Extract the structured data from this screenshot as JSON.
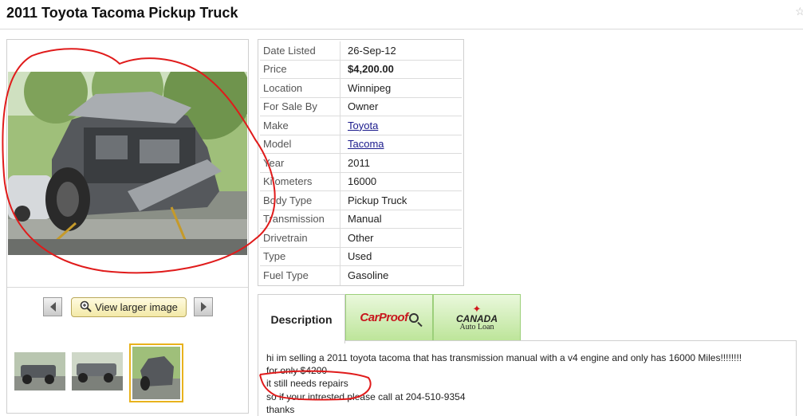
{
  "listing": {
    "title": "2011 Toyota Tacoma Pickup Truck"
  },
  "gallery": {
    "view_larger_label": "View larger image"
  },
  "details": [
    {
      "label": "Date Listed",
      "value": "26-Sep-12",
      "style": ""
    },
    {
      "label": "Price",
      "value": "$4,200.00",
      "style": "bold"
    },
    {
      "label": "Location",
      "value": "Winnipeg",
      "style": ""
    },
    {
      "label": "For Sale By",
      "value": "Owner",
      "style": ""
    },
    {
      "label": "Make",
      "value": "Toyota",
      "style": "link"
    },
    {
      "label": "Model",
      "value": "Tacoma",
      "style": "link"
    },
    {
      "label": "Year",
      "value": "2011",
      "style": ""
    },
    {
      "label": "Kilometers",
      "value": "16000",
      "style": ""
    },
    {
      "label": "Body Type",
      "value": "Pickup Truck",
      "style": ""
    },
    {
      "label": "Transmission",
      "value": "Manual",
      "style": ""
    },
    {
      "label": "Drivetrain",
      "value": "Other",
      "style": ""
    },
    {
      "label": "Type",
      "value": "Used",
      "style": ""
    },
    {
      "label": "Fuel Type",
      "value": "Gasoline",
      "style": ""
    }
  ],
  "tabs": {
    "description": "Description",
    "carproof": "CarProof",
    "canada_big": "CANADA",
    "canada_small": "Auto Loan"
  },
  "description": {
    "lines": [
      "hi im selling a 2011 toyota tacoma that has transmission manual with a v4 engine and only has 16000 Miles!!!!!!!!",
      "for only $4200",
      "it still needs repairs",
      "so if your intrested please call at 204-510-9354",
      "thanks"
    ]
  },
  "colors": {
    "annotation": "#e01b1b",
    "tab_green": "#bde59a",
    "link": "#1a1a8c"
  }
}
